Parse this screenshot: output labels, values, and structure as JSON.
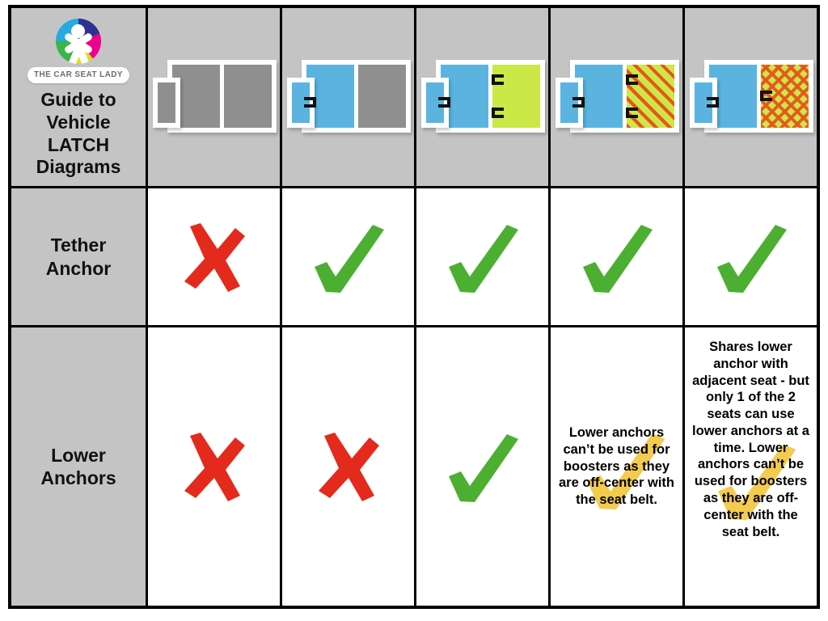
{
  "brand": {
    "pill_text": "THE CAR SEAT LADY",
    "logo_icon": "car-seat-lady-logo"
  },
  "header": {
    "title": "Guide to Vehicle LATCH Diagrams",
    "title_lines": [
      "Guide to",
      "Vehicle",
      "LATCH",
      "Diagrams"
    ]
  },
  "colors": {
    "header_bg": "#c4c4c4",
    "seat_gray": "#8f8f8f",
    "seat_blue": "#5bb4e0",
    "seat_green": "#cbe846",
    "pattern_orange": "#e8541e",
    "check_green": "#4caf32",
    "cross_red": "#e42a1c",
    "highlight_yellow": "#f2cb4f",
    "grid_line": "#000000"
  },
  "rows": [
    {
      "label": "Tether Anchor",
      "label_lines": [
        "Tether",
        "Anchor"
      ],
      "cells": [
        {
          "type": "cross",
          "icon": "red-x-icon"
        },
        {
          "type": "check",
          "icon": "green-check-icon"
        },
        {
          "type": "check",
          "icon": "green-check-icon"
        },
        {
          "type": "check",
          "icon": "green-check-icon"
        },
        {
          "type": "check",
          "icon": "green-check-icon"
        }
      ]
    },
    {
      "label": "Lower Anchors",
      "label_lines": [
        "Lower",
        "Anchors"
      ],
      "cells": [
        {
          "type": "cross",
          "icon": "red-x-icon"
        },
        {
          "type": "cross",
          "icon": "red-x-icon"
        },
        {
          "type": "check",
          "icon": "green-check-icon"
        },
        {
          "type": "note",
          "icon": "yellow-highlight-check-icon",
          "text": "Lower anchors can’t be used for boosters as they are off-center with the seat belt."
        },
        {
          "type": "note",
          "icon": "yellow-highlight-check-icon",
          "text": "Shares lower anchor with adjacent seat - but only 1 of the 2 seats can use lower anchors at a time. Lower anchors can’t be used for boosters as they are off-center with the seat belt."
        }
      ]
    }
  ],
  "diagrams": [
    {
      "name": "diagram-gray-gray-no-anchors",
      "side_seat": {
        "fill": "gray",
        "bracket": "none"
      },
      "seats": [
        {
          "fill": "gray",
          "brackets": []
        },
        {
          "fill": "gray",
          "brackets": []
        }
      ]
    },
    {
      "name": "diagram-blue-anchor-gray",
      "side_seat": {
        "fill": "blue",
        "bracket": "right-mid"
      },
      "seats": [
        {
          "fill": "blue",
          "brackets": []
        },
        {
          "fill": "gray",
          "brackets": []
        }
      ]
    },
    {
      "name": "diagram-blue-anchor-green-two-anchors",
      "side_seat": {
        "fill": "blue",
        "bracket": "right-mid"
      },
      "seats": [
        {
          "fill": "blue",
          "brackets": []
        },
        {
          "fill": "green",
          "brackets": [
            "left-top",
            "left-bottom"
          ]
        }
      ]
    },
    {
      "name": "diagram-blue-anchor-green-striped-two-anchors",
      "side_seat": {
        "fill": "blue",
        "bracket": "right-mid"
      },
      "seats": [
        {
          "fill": "blue",
          "brackets": []
        },
        {
          "fill": "stripe",
          "brackets": [
            "left-top",
            "left-bottom"
          ]
        }
      ]
    },
    {
      "name": "diagram-blue-anchor-green-diamond-shared-anchor",
      "side_seat": {
        "fill": "blue",
        "bracket": "right-mid"
      },
      "seats": [
        {
          "fill": "blue",
          "brackets": []
        },
        {
          "fill": "diamond",
          "brackets": [
            "left-mid"
          ]
        }
      ]
    }
  ]
}
